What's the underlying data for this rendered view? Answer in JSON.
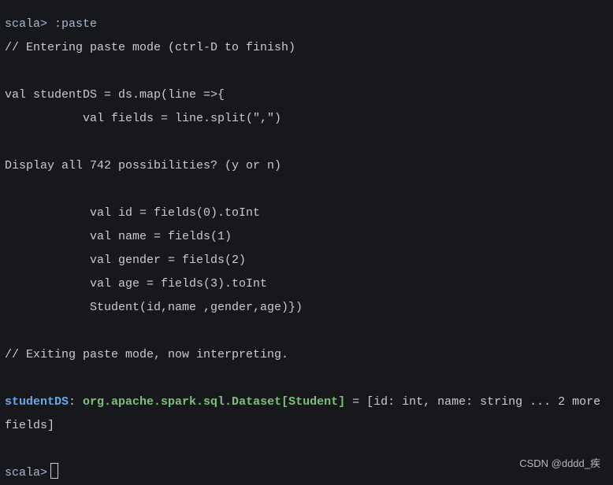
{
  "terminal": {
    "prompt": "scala>",
    "command": ":paste",
    "entering": "// Entering paste mode (ctrl-D to finish)",
    "code1": "val studentDS = ds.map(line =>{",
    "code2": "           val fields = line.split(\",\")",
    "possibilities": "Display all 742 possibilities? (y or n)",
    "code3": "            val id = fields(0).toInt",
    "code4": "            val name = fields(1)",
    "code5": "            val gender = fields(2)",
    "code6": "            val age = fields(3).toInt",
    "code7": "            Student(id,name ,gender,age)})",
    "exiting": "// Exiting paste mode, now interpreting.",
    "result_ident": "studentDS",
    "result_colon": ": ",
    "result_type": "org.apache.spark.sql.Dataset[Student]",
    "result_rest": " = [id: int, name: string ... 2 more",
    "result_wrap": "fields]"
  },
  "watermark": "CSDN @dddd_疾",
  "colors": {
    "background": "#17181b",
    "text": "#c9cbcf",
    "identifier": "#6aa8e8",
    "type": "#7cc07c"
  }
}
